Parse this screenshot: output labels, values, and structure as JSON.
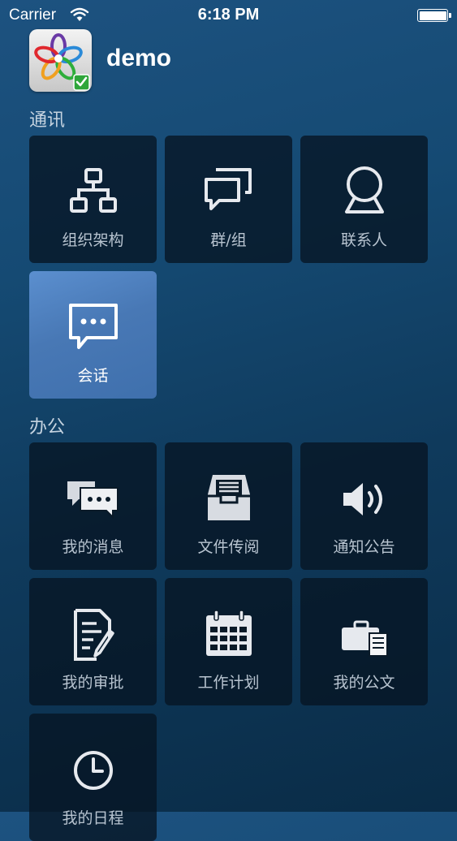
{
  "status_bar": {
    "carrier": "Carrier",
    "time": "6:18 PM"
  },
  "header": {
    "title": "demo",
    "logo_icon": "flower-logo-icon"
  },
  "sections": [
    {
      "title": "通讯",
      "items": [
        {
          "label": "组织架构",
          "icon": "org-chart-icon",
          "active": false
        },
        {
          "label": "群/组",
          "icon": "group-chat-icon",
          "active": false
        },
        {
          "label": "联系人",
          "icon": "contact-icon",
          "active": false
        },
        {
          "label": "会话",
          "icon": "chat-bubble-icon",
          "active": true
        }
      ]
    },
    {
      "title": "办公",
      "items": [
        {
          "label": "我的消息",
          "icon": "messages-icon",
          "active": false
        },
        {
          "label": "文件传阅",
          "icon": "inbox-tray-icon",
          "active": false
        },
        {
          "label": "通知公告",
          "icon": "speaker-icon",
          "active": false
        },
        {
          "label": "我的审批",
          "icon": "document-edit-icon",
          "active": false
        },
        {
          "label": "工作计划",
          "icon": "calendar-icon",
          "active": false
        },
        {
          "label": "我的公文",
          "icon": "briefcase-document-icon",
          "active": false
        },
        {
          "label": "我的日程",
          "icon": "clock-icon",
          "active": false
        }
      ]
    }
  ],
  "colors": {
    "tile_bg": "#06141f",
    "active_tile": "#4a7bb8",
    "icon_color": "#e6e9ee",
    "label_color": "#b8c4d0"
  }
}
